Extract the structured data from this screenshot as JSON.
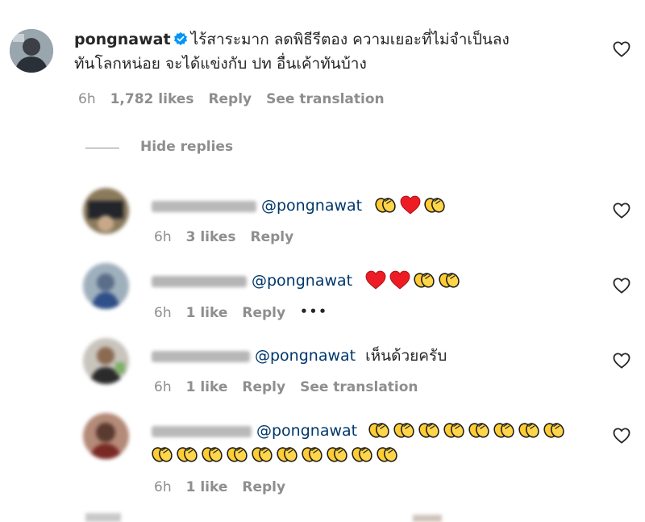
{
  "main_comment": {
    "username": "pongnawat",
    "text_line1": "ไร้สาระมาก ลดพิธีรีตอง ความเยอะที่ไม่จำเป็นลง",
    "text_line2": "ทันโลกหน่อย จะได้แข่งกับ ปท อื่นเค้าทันบ้าง",
    "time": "6h",
    "likes": "1,782 likes",
    "reply": "Reply",
    "see_translation": "See translation"
  },
  "replies_toggle": {
    "label": "Hide replies"
  },
  "replies": [
    {
      "mention": "@pongnawat",
      "emoji": [
        "clap",
        "red-heart",
        "clap"
      ],
      "time": "6h",
      "likes": "3 likes",
      "reply": "Reply"
    },
    {
      "mention": "@pongnawat",
      "emoji": [
        "red-heart",
        "red-heart",
        "clap",
        "clap"
      ],
      "time": "6h",
      "likes": "1 like",
      "reply": "Reply",
      "more": "•••"
    },
    {
      "mention": "@pongnawat",
      "text": "เห็นด้วยครับ",
      "time": "6h",
      "likes": "1 like",
      "reply": "Reply",
      "see_translation": "See translation"
    },
    {
      "mention": "@pongnawat",
      "emoji_line1_count": 8,
      "emoji_line2_count": 10,
      "emoji": "clap",
      "time": "6h",
      "likes": "1 like",
      "reply": "Reply"
    }
  ],
  "colors": {
    "text": "#262626",
    "secondary": "#8e8e8e",
    "mention": "#00376b",
    "verified": "#0095f6",
    "red_heart": "#ed1c24",
    "clap": "#ffcc33"
  }
}
